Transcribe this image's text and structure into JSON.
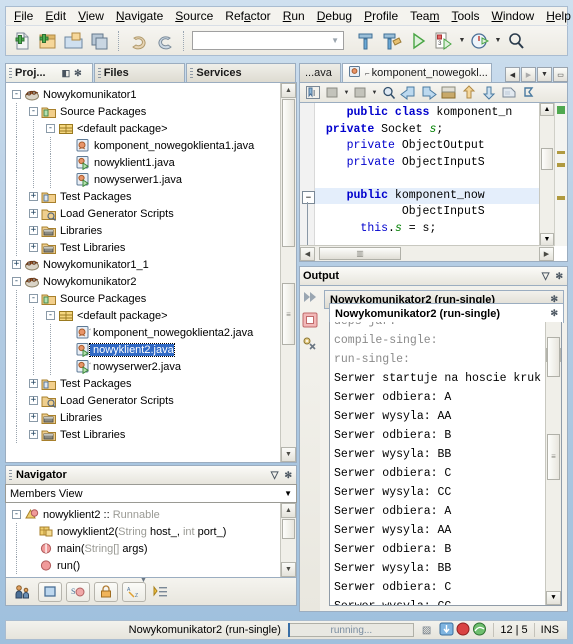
{
  "menubar": {
    "items": [
      "File",
      "Edit",
      "View",
      "Navigate",
      "Source",
      "Refactor",
      "Run",
      "Debug",
      "Profile",
      "Team",
      "Tools",
      "Window",
      "Help"
    ]
  },
  "toolbar": {
    "buttons": [
      "new-file-icon",
      "new-project-icon",
      "open-project-icon",
      "save-all-icon",
      "undo-icon",
      "redo-icon"
    ],
    "config_combo_value": "",
    "right_buttons": [
      "build-project-icon",
      "clean-build-icon",
      "run-project-icon",
      "debug-project-icon",
      "profile-project-icon",
      "search-icon"
    ]
  },
  "window_tabs": [
    {
      "label": "Proj...",
      "active": true
    },
    {
      "label": "Files",
      "active": false
    },
    {
      "label": "Services",
      "active": false
    }
  ],
  "projects_tree": [
    {
      "indent": 0,
      "expander": "-",
      "icon": "project-icon",
      "label": "Nowykomunikator1",
      "selected": false
    },
    {
      "indent": 1,
      "expander": "-",
      "icon": "source-packages-icon",
      "label": "Source Packages",
      "selected": false
    },
    {
      "indent": 2,
      "expander": "-",
      "icon": "package-icon",
      "label": "<default package>",
      "selected": false
    },
    {
      "indent": 3,
      "expander": "",
      "icon": "java-class-icon",
      "label": "komponent_nowegoklienta1.java",
      "selected": false
    },
    {
      "indent": 3,
      "expander": "",
      "icon": "java-main-icon",
      "label": "nowyklient1.java",
      "selected": false
    },
    {
      "indent": 3,
      "expander": "",
      "icon": "java-main-icon",
      "label": "nowyserwer1.java",
      "selected": false
    },
    {
      "indent": 1,
      "expander": "+",
      "icon": "test-packages-icon",
      "label": "Test Packages",
      "selected": false
    },
    {
      "indent": 1,
      "expander": "+",
      "icon": "load-generator-icon",
      "label": "Load Generator Scripts",
      "selected": false
    },
    {
      "indent": 1,
      "expander": "+",
      "icon": "libraries-icon",
      "label": "Libraries",
      "selected": false
    },
    {
      "indent": 1,
      "expander": "+",
      "icon": "test-libraries-icon",
      "label": "Test Libraries",
      "selected": false
    },
    {
      "indent": 0,
      "expander": "+",
      "icon": "project-icon",
      "label": "Nowykomunikator1_1",
      "selected": false
    },
    {
      "indent": 0,
      "expander": "-",
      "icon": "project-icon",
      "label": "Nowykomunikator2",
      "selected": false
    },
    {
      "indent": 1,
      "expander": "-",
      "icon": "source-packages-icon",
      "label": "Source Packages",
      "selected": false
    },
    {
      "indent": 2,
      "expander": "-",
      "icon": "package-icon",
      "label": "<default package>",
      "selected": false
    },
    {
      "indent": 3,
      "expander": "",
      "icon": "java-class-badge-icon",
      "label": "komponent_nowegoklienta2.java",
      "selected": false
    },
    {
      "indent": 3,
      "expander": "",
      "icon": "java-main-badge-icon",
      "label": "nowyklient2.java",
      "selected": true
    },
    {
      "indent": 3,
      "expander": "",
      "icon": "java-main-badge-icon",
      "label": "nowyserwer2.java",
      "selected": false
    },
    {
      "indent": 1,
      "expander": "+",
      "icon": "test-packages-icon",
      "label": "Test Packages",
      "selected": false
    },
    {
      "indent": 1,
      "expander": "+",
      "icon": "load-generator-icon",
      "label": "Load Generator Scripts",
      "selected": false
    },
    {
      "indent": 1,
      "expander": "+",
      "icon": "libraries-icon",
      "label": "Libraries",
      "selected": false
    },
    {
      "indent": 1,
      "expander": "+",
      "icon": "test-libraries-icon",
      "label": "Test Libraries",
      "selected": false
    }
  ],
  "navigator": {
    "title": "Navigator",
    "view_select": "Members View",
    "members": [
      {
        "indent": 0,
        "expander": "-",
        "icon": "class-interface-icon",
        "main": "nowyklient2 :: ",
        "dim": "Runnable"
      },
      {
        "indent": 1,
        "expander": "",
        "icon": "constructor-icon",
        "main": "nowyklient2(",
        "dim": "String",
        "main2": " host_, ",
        "dim2": "int",
        "main3": " port_)"
      },
      {
        "indent": 1,
        "expander": "",
        "icon": "method-static-icon",
        "main": "main(",
        "dim": "String[]",
        "main2": " args)"
      },
      {
        "indent": 1,
        "expander": "",
        "icon": "method-icon",
        "main": "run()"
      }
    ],
    "buttons": [
      "show-inherited-members-icon",
      "show-fields-icon",
      "show-static-icon",
      "show-non-public-icon",
      "sort-alphabetically-icon",
      "expand-all-icon"
    ]
  },
  "editor": {
    "tabs": [
      {
        "label": "...ava",
        "active": false,
        "icon": ""
      },
      {
        "label": "komponent_nowegokl...",
        "active": true,
        "icon": "java-class-badge-icon"
      }
    ],
    "controls": [
      "scroll-left-icon",
      "scroll-right-icon",
      "tab-list-icon",
      "maximize-icon"
    ],
    "toolbar_buttons": [
      "toggle-bookmark-icon",
      "last-edit-icon",
      "back-icon",
      "find-selection-icon",
      "previous-bookmark-icon",
      "next-bookmark-icon",
      "toggle-rectangular-selection-icon",
      "shift-line-left-icon",
      "shift-line-right-icon",
      "start-macro-recording-icon",
      "comment-icon"
    ],
    "code_lines": [
      {
        "indent": 4,
        "hl": false,
        "tokens": [
          {
            "t": "kw",
            "v": "public class "
          },
          {
            "t": "pln",
            "v": "komponent_n"
          }
        ]
      },
      {
        "indent": 1,
        "hl": false,
        "tokens": [
          {
            "t": "kw",
            "v": "private "
          },
          {
            "t": "pln",
            "v": "Socket "
          },
          {
            "t": "fld",
            "v": "s"
          },
          {
            "t": "pln",
            "v": ";"
          }
        ]
      },
      {
        "indent": 4,
        "hl": false,
        "tokens": [
          {
            "t": "kw2",
            "v": "private "
          },
          {
            "t": "pln",
            "v": "ObjectOutput"
          }
        ]
      },
      {
        "indent": 4,
        "hl": false,
        "tokens": [
          {
            "t": "kw2",
            "v": "private "
          },
          {
            "t": "pln",
            "v": "ObjectInputS"
          }
        ]
      },
      {
        "indent": 0,
        "hl": false,
        "tokens": []
      },
      {
        "indent": 4,
        "hl": true,
        "tokens": [
          {
            "t": "kw",
            "v": "public "
          },
          {
            "t": "pln",
            "v": "komponent_now"
          }
        ]
      },
      {
        "indent": 12,
        "hl": false,
        "tokens": [
          {
            "t": "pln",
            "v": "ObjectInputS"
          }
        ]
      },
      {
        "indent": 6,
        "hl": false,
        "tokens": [
          {
            "t": "kw2",
            "v": "this"
          },
          {
            "t": "pln",
            "v": "."
          },
          {
            "t": "fld",
            "v": "s"
          },
          {
            "t": "pln",
            "v": " = s;"
          }
        ]
      }
    ]
  },
  "output": {
    "title": "Output",
    "side_buttons": [
      "rerun-icon",
      "stop-icon",
      "ant-settings-icon"
    ],
    "tabs": [
      {
        "label": "Nowykomunikator2 (run-single)",
        "front": false
      },
      {
        "label": "Nowykomunikator2 (run-single)",
        "front": true
      }
    ],
    "lines": [
      {
        "text": "deps-jar:",
        "dim": true
      },
      {
        "text": "compile-single:",
        "dim": true
      },
      {
        "text": "run-single:",
        "dim": true
      },
      {
        "text": "Serwer startuje na hoscie kruk",
        "dim": false
      },
      {
        "text": "Serwer odbiera: A",
        "dim": false
      },
      {
        "text": "Serwer wysyla: AA",
        "dim": false
      },
      {
        "text": "Serwer odbiera: B",
        "dim": false
      },
      {
        "text": "Serwer wysyla: BB",
        "dim": false
      },
      {
        "text": "Serwer odbiera: C",
        "dim": false
      },
      {
        "text": "Serwer wysyla: CC",
        "dim": false
      },
      {
        "text": "Serwer odbiera: A",
        "dim": false
      },
      {
        "text": "Serwer wysyla: AA",
        "dim": false
      },
      {
        "text": "Serwer odbiera: B",
        "dim": false
      },
      {
        "text": "Serwer wysyla: BB",
        "dim": false
      },
      {
        "text": "Serwer odbiera: C",
        "dim": false
      },
      {
        "text": "Serwer wysyla: CC",
        "dim": false
      }
    ]
  },
  "statusbar": {
    "task": "Nowykomunikator2 (run-single)",
    "progress_label": "running...",
    "icons": [
      "stop-task-icon",
      "notifications-icon",
      "memory-icon",
      "background-tasks-icon"
    ],
    "caret_position": "12 | 5",
    "insert_mode": "INS"
  },
  "colors": {
    "selection_blue": "#316ac5",
    "keyword_blue": "#0000cd",
    "field_green": "#008000",
    "window_bg": "#b5cde4"
  }
}
